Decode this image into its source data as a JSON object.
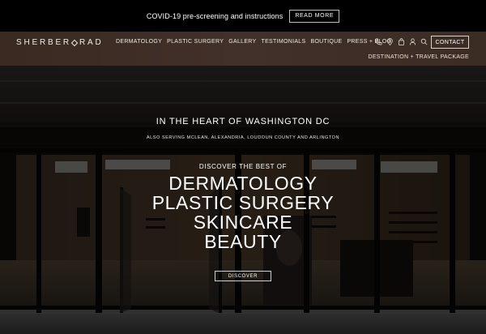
{
  "announcement": {
    "text": "COVID-19 pre-screening and instructions",
    "button_label": "READ MORE"
  },
  "header": {
    "logo_left": "SHERBER",
    "logo_right": "RAD",
    "nav": [
      {
        "label": "DERMATOLOGY"
      },
      {
        "label": "PLASTIC SURGERY"
      },
      {
        "label": "GALLERY"
      },
      {
        "label": "TESTIMONIALS"
      },
      {
        "label": "BOUTIQUE"
      },
      {
        "label": "PRESS + BLOG"
      }
    ],
    "icons": [
      "phone-icon",
      "location-pin-icon",
      "shopping-bag-icon",
      "user-icon",
      "search-icon"
    ],
    "contact_label": "CONTACT",
    "destination_label": "DESTINATION + TRAVEL PACKAGE"
  },
  "hero": {
    "heading": "IN THE HEART OF WASHINGTON DC",
    "subheading": "ALSO SERVING MCLEAN, ALEXANDRIA, LOUDOUN COUNTY AND ARLINGTON",
    "discover_intro": "DISCOVER THE BEST OF",
    "services": [
      "DERMATOLOGY",
      "PLASTIC SURGERY",
      "SKINCARE",
      "BEAUTY"
    ],
    "button_label": "DISCOVER"
  },
  "colors": {
    "header_bg": "#3f2e26",
    "announcement_bg": "#000000",
    "text": "#ffffff"
  }
}
